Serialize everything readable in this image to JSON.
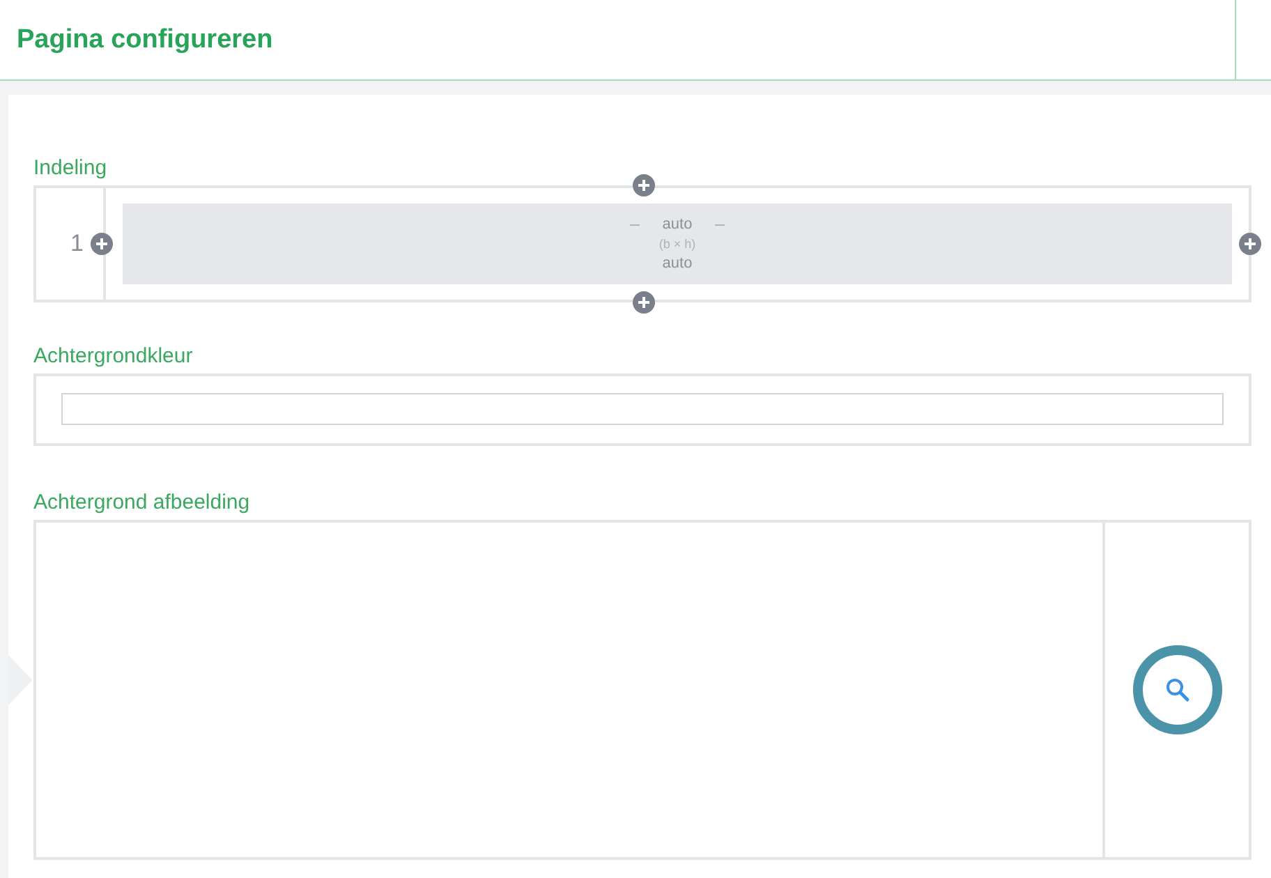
{
  "header": {
    "title": "Pagina configureren"
  },
  "layout": {
    "label": "Indeling",
    "rows": [
      {
        "number": "1",
        "cells": [
          {
            "width": "auto",
            "size_hint": "(b × h)",
            "height": "auto"
          }
        ]
      }
    ]
  },
  "background_color": {
    "label": "Achtergrondkleur"
  },
  "background_image": {
    "label": "Achtergrond afbeelding"
  }
}
